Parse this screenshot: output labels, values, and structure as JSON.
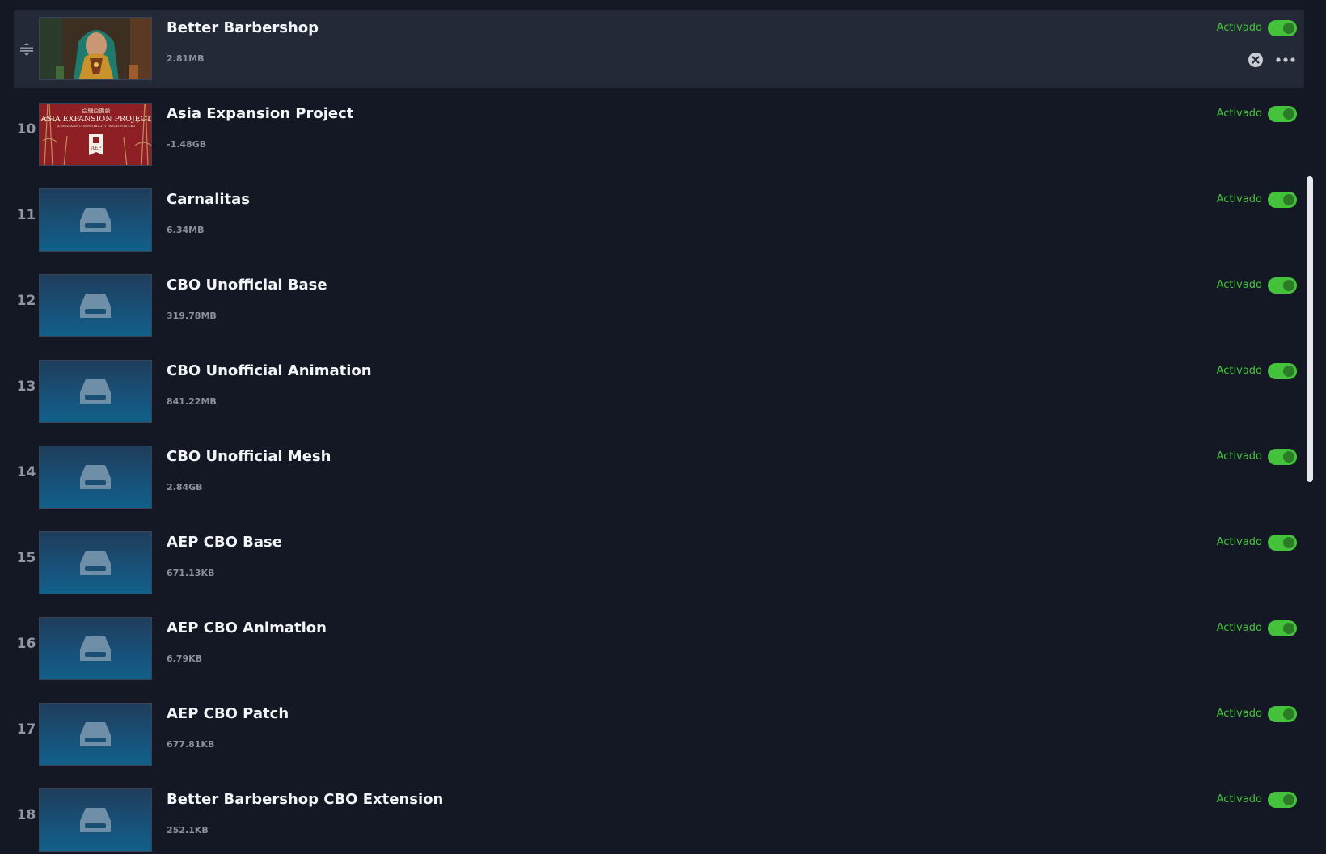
{
  "colors": {
    "background": "#141824",
    "row_hover": "#242938",
    "accent_green": "#44c23b",
    "status_text": "#49c03e"
  },
  "mods": [
    {
      "order": "",
      "name": "Better Barbershop",
      "size": "2.81MB",
      "status": "Activado",
      "enabled": true,
      "thumbnail": "portrait-image"
    },
    {
      "order": "10",
      "name": "Asia Expansion Project",
      "size": "-1.48GB",
      "status": "Activado",
      "enabled": true,
      "thumbnail": "asia-banner-image"
    },
    {
      "order": "11",
      "name": "Carnalitas",
      "size": "6.34MB",
      "status": "Activado",
      "enabled": true,
      "thumbnail": "drive-icon"
    },
    {
      "order": "12",
      "name": "CBO Unofficial Base",
      "size": "319.78MB",
      "status": "Activado",
      "enabled": true,
      "thumbnail": "drive-icon"
    },
    {
      "order": "13",
      "name": "CBO Unofficial Animation",
      "size": "841.22MB",
      "status": "Activado",
      "enabled": true,
      "thumbnail": "drive-icon"
    },
    {
      "order": "14",
      "name": "CBO Unofficial Mesh",
      "size": "2.84GB",
      "status": "Activado",
      "enabled": true,
      "thumbnail": "drive-icon"
    },
    {
      "order": "15",
      "name": "AEP CBO Base",
      "size": "671.13KB",
      "status": "Activado",
      "enabled": true,
      "thumbnail": "drive-icon"
    },
    {
      "order": "16",
      "name": "AEP CBO Animation",
      "size": "6.79KB",
      "status": "Activado",
      "enabled": true,
      "thumbnail": "drive-icon"
    },
    {
      "order": "17",
      "name": "AEP CBO Patch",
      "size": "677.81KB",
      "status": "Activado",
      "enabled": true,
      "thumbnail": "drive-icon"
    },
    {
      "order": "18",
      "name": "Better Barbershop CBO Extension",
      "size": "252.1KB",
      "status": "Activado",
      "enabled": true,
      "thumbnail": "drive-icon"
    }
  ],
  "banner": {
    "small_text": "亞細亞擴張",
    "title": "ASIA EXPANSION PROJECT",
    "subtitle": "A MOD AND COMPATIBILITY PATCH FOR CK3",
    "logo": "AEP"
  }
}
